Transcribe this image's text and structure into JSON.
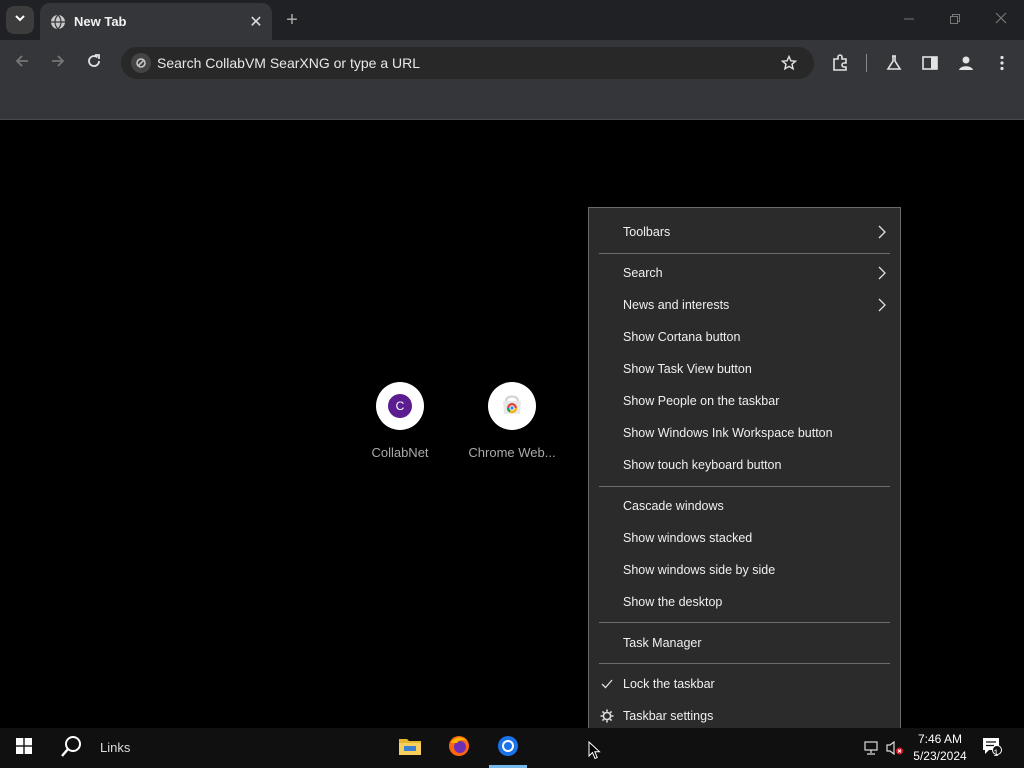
{
  "browser": {
    "tab_title": "New Tab",
    "close_glyph": "✕",
    "new_tab_glyph": "+",
    "omnibox_placeholder": "Search CollabVM SearXNG or type a URL"
  },
  "shortcuts": [
    {
      "label": "CollabNet",
      "letter": "C",
      "color": "#5b1d8f"
    },
    {
      "label": "Chrome Web..."
    }
  ],
  "context_menu": {
    "items": [
      {
        "label": "Toolbars",
        "submenu": true
      },
      {
        "label": "Search",
        "submenu": true
      },
      {
        "label": "News and interests",
        "submenu": true
      },
      {
        "label": "Show Cortana button"
      },
      {
        "label": "Show Task View button"
      },
      {
        "label": "Show People on the taskbar"
      },
      {
        "label": "Show Windows Ink Workspace button"
      },
      {
        "label": "Show touch keyboard button"
      },
      {
        "label": "Cascade windows"
      },
      {
        "label": "Show windows stacked"
      },
      {
        "label": "Show windows side by side"
      },
      {
        "label": "Show the desktop"
      },
      {
        "label": "Task Manager"
      },
      {
        "label": "Lock the taskbar",
        "checked": true
      },
      {
        "label": "Taskbar settings",
        "icon": "gear-icon"
      }
    ]
  },
  "taskbar": {
    "links_label": "Links",
    "time": "7:46 AM",
    "date": "5/23/2024",
    "notification_count": "1"
  },
  "colors": {
    "accent_blue": "#76b9ed",
    "menu_bg": "#2b2b2b",
    "tab_active": "#35363a"
  }
}
